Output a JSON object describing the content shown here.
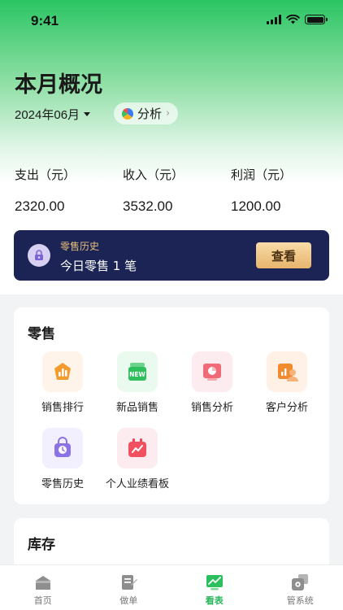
{
  "status_bar": {
    "time": "9:41"
  },
  "header": {
    "title": "本月概况",
    "month": "2024年06月",
    "analysis_label": "分析"
  },
  "stats": [
    {
      "label": "支出（元）",
      "value": "2320.00"
    },
    {
      "label": "收入（元）",
      "value": "3532.00"
    },
    {
      "label": "利润（元）",
      "value": "1200.00"
    }
  ],
  "history_banner": {
    "subtitle": "零售历史",
    "text": "今日零售 1 笔",
    "button_label": "查看"
  },
  "retail_section": {
    "title": "零售",
    "items": [
      {
        "label": "销售排行",
        "icon": "sales-ranking-icon"
      },
      {
        "label": "新品销售",
        "icon": "new-product-icon"
      },
      {
        "label": "销售分析",
        "icon": "sales-analysis-icon"
      },
      {
        "label": "客户分析",
        "icon": "customer-analysis-icon"
      },
      {
        "label": "零售历史",
        "icon": "retail-history-icon"
      },
      {
        "label": "个人业绩看板",
        "icon": "performance-board-icon"
      }
    ]
  },
  "stock_section": {
    "title": "库存"
  },
  "tabbar": {
    "tabs": [
      {
        "label": "首页",
        "icon": "home-icon",
        "active": false
      },
      {
        "label": "做单",
        "icon": "order-icon",
        "active": false
      },
      {
        "label": "看表",
        "icon": "report-icon",
        "active": true
      },
      {
        "label": "管系统",
        "icon": "settings-icon",
        "active": false
      }
    ]
  },
  "colors": {
    "accent_green": "#27b55a",
    "banner_navy": "#1b2454",
    "gold": "#e9c07a"
  }
}
